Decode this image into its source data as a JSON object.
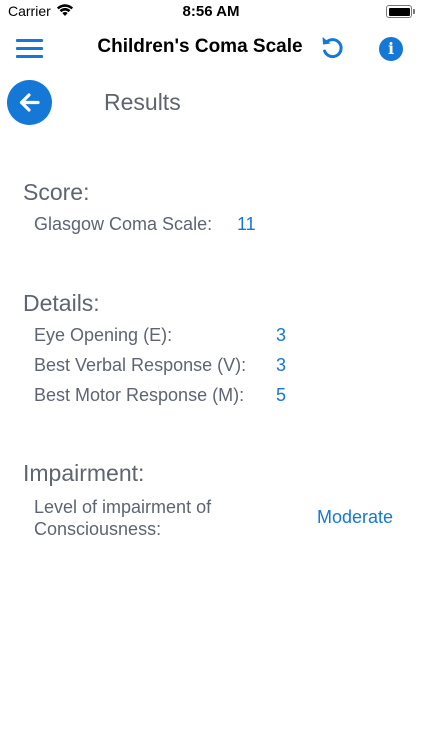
{
  "status_bar": {
    "carrier": "Carrier",
    "time": "8:56 AM"
  },
  "nav": {
    "title": "Children's Coma Scale"
  },
  "page": {
    "title": "Results"
  },
  "score": {
    "heading": "Score:",
    "label": "Glasgow Coma Scale:",
    "value": "11"
  },
  "details": {
    "heading": "Details:",
    "rows": [
      {
        "label": "Eye Opening (E):",
        "value": "3"
      },
      {
        "label": "Best Verbal Response (V):",
        "value": "3"
      },
      {
        "label": "Best Motor Response (M):",
        "value": "5"
      }
    ]
  },
  "impairment": {
    "heading": "Impairment:",
    "label": "Level of impairment of Consciousness:",
    "value": "Moderate"
  },
  "colors": {
    "accent": "#1577d6",
    "label_text": "#5e6570"
  }
}
